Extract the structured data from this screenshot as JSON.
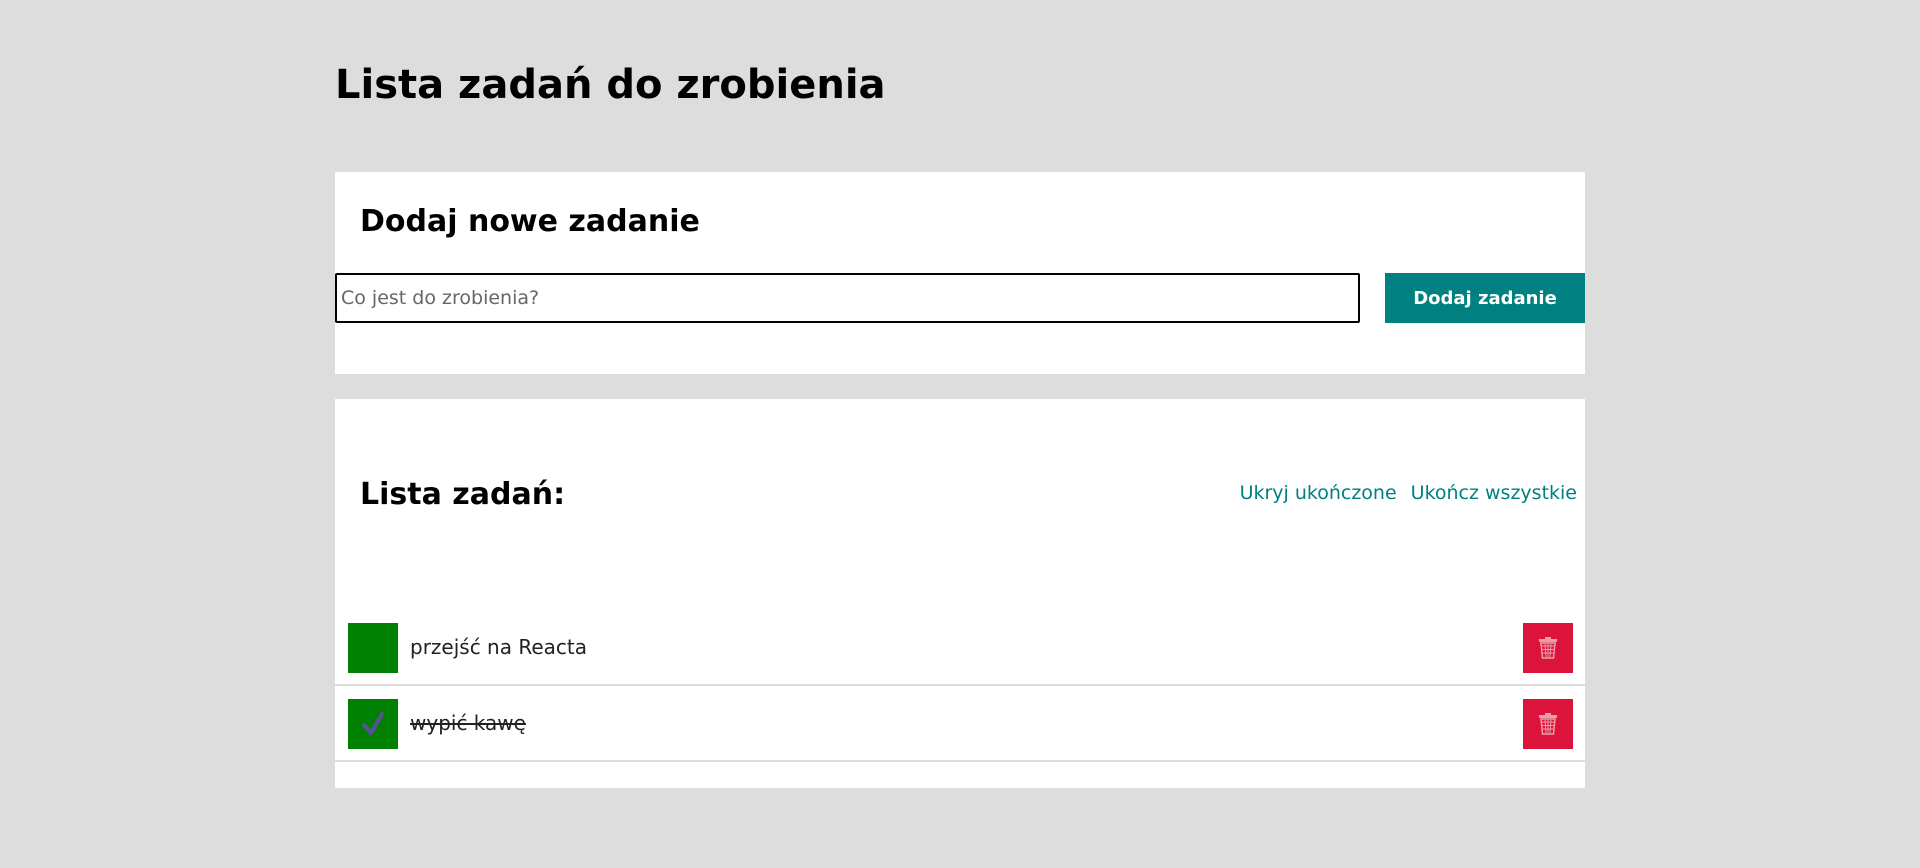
{
  "header": {
    "title": "Lista zadań do zrobienia"
  },
  "form": {
    "heading": "Dodaj nowe zadanie",
    "input_placeholder": "Co jest do zrobienia?",
    "input_value": "",
    "add_button_label": "Dodaj zadanie"
  },
  "list": {
    "heading": "Lista zadań:",
    "hide_done_label": "Ukryj ukończone",
    "finish_all_label": "Ukończ wszystkie",
    "tasks": [
      {
        "content": "przejść na Reacta",
        "done": false
      },
      {
        "content": "wypić kawę",
        "done": true
      }
    ]
  },
  "colors": {
    "background": "#dddddd",
    "accent": "#008080",
    "toggle": "#008000",
    "remove": "#dc143c"
  },
  "icons": {
    "check": "check-icon",
    "remove": "trash-icon"
  }
}
